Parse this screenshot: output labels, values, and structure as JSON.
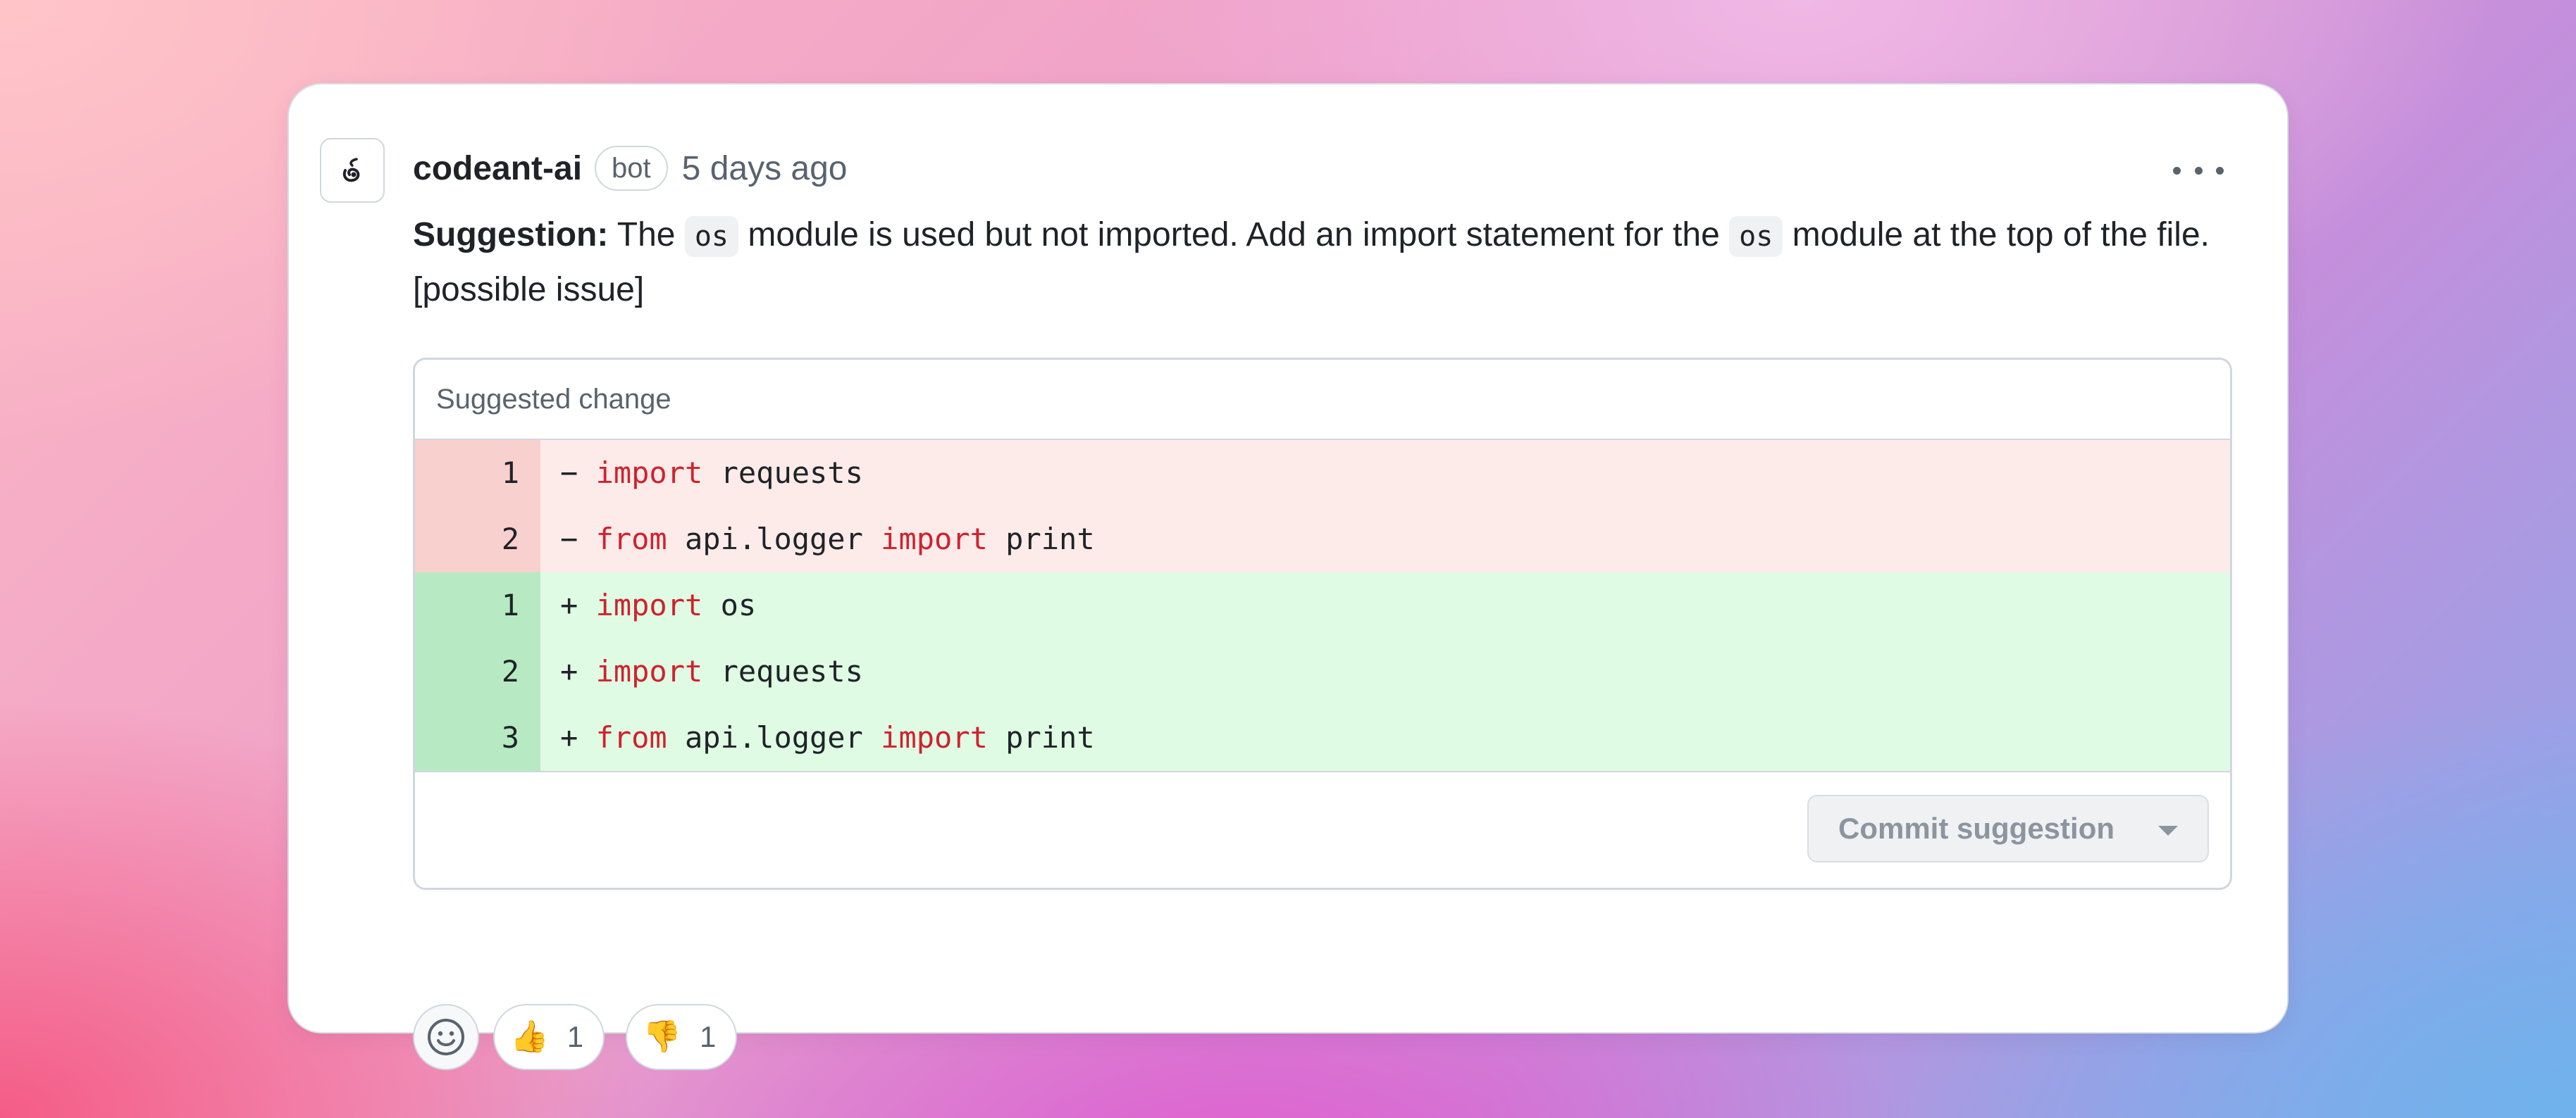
{
  "comment": {
    "author": "codeant-ai",
    "badge": "bot",
    "timestamp": "5 days ago",
    "more_icon": "kebab-horizontal-icon",
    "avatar_icon": "codeant-logo-icon",
    "body": {
      "label": "Suggestion:",
      "part1": " The ",
      "code1": "os",
      "part2": " module is used but not imported. Add an import statement for the ",
      "code2": "os",
      "part3": " module at the top of the file. [possible issue]"
    }
  },
  "suggestion": {
    "header": "Suggested change",
    "removed_lines": [
      {
        "num": "1",
        "sign": "−",
        "tokens": [
          {
            "t": "import",
            "kw": true
          },
          {
            "t": " requests",
            "kw": false
          }
        ]
      },
      {
        "num": "2",
        "sign": "−",
        "tokens": [
          {
            "t": "from",
            "kw": true
          },
          {
            "t": " api.logger ",
            "kw": false
          },
          {
            "t": "import",
            "kw": true
          },
          {
            "t": " print",
            "kw": false
          }
        ]
      }
    ],
    "added_lines": [
      {
        "num": "1",
        "sign": "+",
        "tokens": [
          {
            "t": "import",
            "kw": true
          },
          {
            "t": " os",
            "kw": false
          }
        ]
      },
      {
        "num": "2",
        "sign": "+",
        "tokens": [
          {
            "t": "import",
            "kw": true
          },
          {
            "t": " requests",
            "kw": false
          }
        ]
      },
      {
        "num": "3",
        "sign": "+",
        "tokens": [
          {
            "t": "from",
            "kw": true
          },
          {
            "t": " api.logger ",
            "kw": false
          },
          {
            "t": "import",
            "kw": true
          },
          {
            "t": " print",
            "kw": false
          }
        ]
      }
    ],
    "commit_label": "Commit suggestion"
  },
  "reactions": {
    "add_icon": "smiley-icon",
    "items": [
      {
        "name": "thumbs-up",
        "emoji": "👍",
        "count": "1"
      },
      {
        "name": "thumbs-down",
        "emoji": "👎",
        "count": "1"
      }
    ]
  },
  "colors": {
    "keyword": "#cf222e",
    "deleted_bg": "#fdebe9",
    "added_bg": "#dffbe3"
  }
}
